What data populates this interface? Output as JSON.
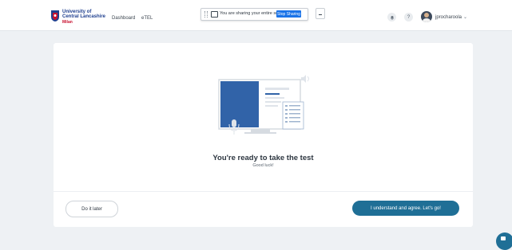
{
  "header": {
    "logo": {
      "line1": "University of",
      "line2": "Central Lancashire",
      "line3": "Milan"
    },
    "nav": {
      "dashboard": "Dashboard",
      "etel": "eTEL"
    },
    "icons": {
      "bell": "bell-icon",
      "help": "?"
    },
    "user": {
      "name": "jprocharoola",
      "chevron": "⌄"
    }
  },
  "share_banner": {
    "message": "You are sharing your entire screen.",
    "stop_label": "Stop Sharing"
  },
  "card": {
    "title": "You're ready to take the test",
    "subtitle": "Good luck!",
    "later_label": "Do it later",
    "agree_label": "I understand and agree. Let's go!"
  },
  "colors": {
    "primary": "#1f6f96",
    "share_blue": "#1a73e8",
    "page_bg": "#eef1f4"
  }
}
